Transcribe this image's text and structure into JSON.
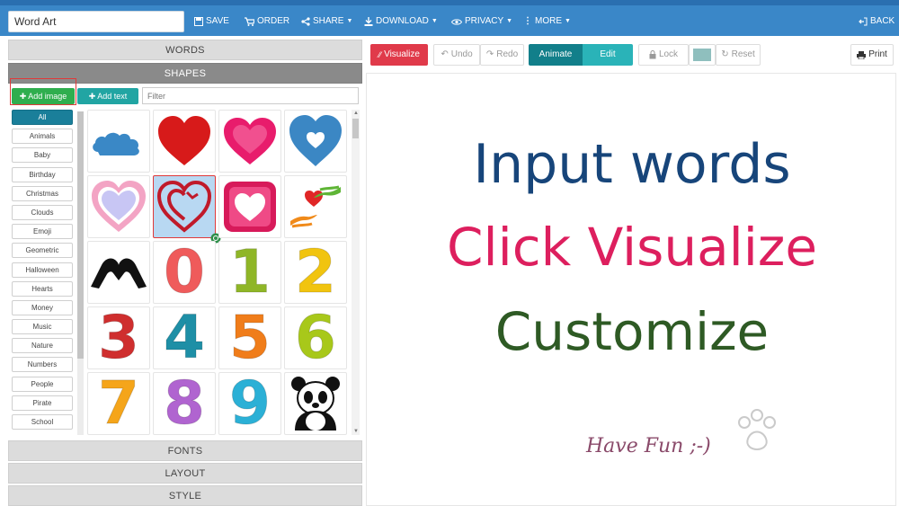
{
  "topbar": {
    "title_value": "Word Art",
    "save": "SAVE",
    "order": "ORDER",
    "share": "SHARE",
    "download": "DOWNLOAD",
    "privacy": "PRIVACY",
    "more": "MORE",
    "back": "BACK"
  },
  "sidebar": {
    "sections": {
      "words": "WORDS",
      "shapes": "SHAPES",
      "fonts": "FONTS",
      "layout": "LAYOUT",
      "style": "STYLE"
    },
    "add_image": "Add image",
    "add_text": "Add text",
    "filter_placeholder": "Filter",
    "categories": [
      "All",
      "Animals",
      "Baby",
      "Birthday",
      "Christmas",
      "Clouds",
      "Emoji",
      "Geometric",
      "Halloween",
      "Hearts",
      "Money",
      "Music",
      "Nature",
      "Numbers",
      "People",
      "Pirate",
      "School"
    ],
    "shape_digits": [
      "0",
      "1",
      "2",
      "3",
      "4",
      "5",
      "6",
      "7",
      "8",
      "9"
    ]
  },
  "toolbar": {
    "visualize": "Visualize",
    "undo": "Undo",
    "redo": "Redo",
    "animate": "Animate",
    "edit": "Edit",
    "lock": "Lock",
    "reset": "Reset",
    "print": "Print",
    "color_swatch": "#8fbfbe"
  },
  "canvas": {
    "line1": "Input words",
    "line2": "Click Visualize",
    "line3": "Customize",
    "signature": "Have Fun ;-)"
  },
  "colors": {
    "topbar": "#3a87c8",
    "visualize": "#e03a4a",
    "animate": "#127f8a",
    "edit": "#2ab3b8",
    "line1": "#17457a",
    "line2": "#dd1f5e",
    "line3": "#2e5a24"
  }
}
